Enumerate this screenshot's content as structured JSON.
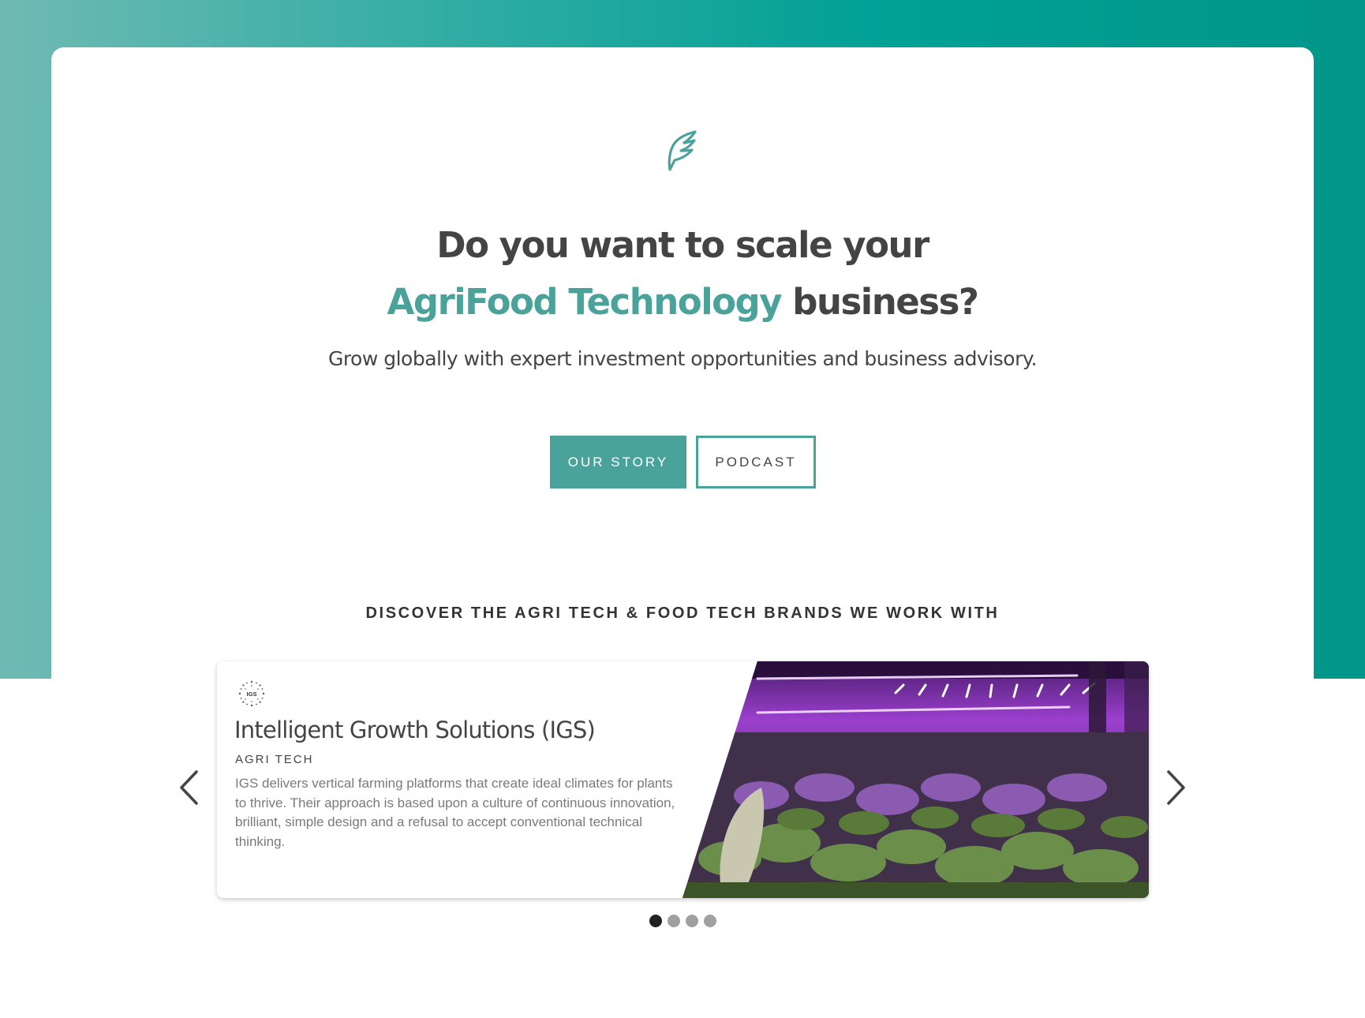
{
  "hero": {
    "headline_line1": "Do you want to scale your",
    "headline_accent": "AgriFood Technology",
    "headline_rest": " business?",
    "subtitle": "Grow globally with expert investment opportunities and business advisory."
  },
  "buttons": {
    "our_story": "OUR STORY",
    "podcast": "PODCAST"
  },
  "brands_section": {
    "heading": "DISCOVER THE AGRI TECH & FOOD TECH BRANDS WE WORK WITH"
  },
  "carousel": {
    "active_slide": 1,
    "slide_count": 4,
    "current": {
      "logo_text": "IGS",
      "title": "Intelligent Growth Solutions (IGS)",
      "category": "AGRI TECH",
      "description": "IGS delivers vertical farming platforms that create ideal climates for plants to thrive. Their approach is based upon a culture of continuous innovation, brilliant, simple design and a refusal to accept conventional technical thinking."
    }
  },
  "icons": {
    "logo": "leaf-feather-icon",
    "prev": "chevron-left-icon",
    "next": "chevron-right-icon"
  },
  "colors": {
    "accent": "#4aa39b",
    "band_start": "#6fbab3",
    "band_end": "#00968a",
    "text": "#444444",
    "dot_active": "#222222",
    "dot_inactive": "#a0a0a0"
  }
}
